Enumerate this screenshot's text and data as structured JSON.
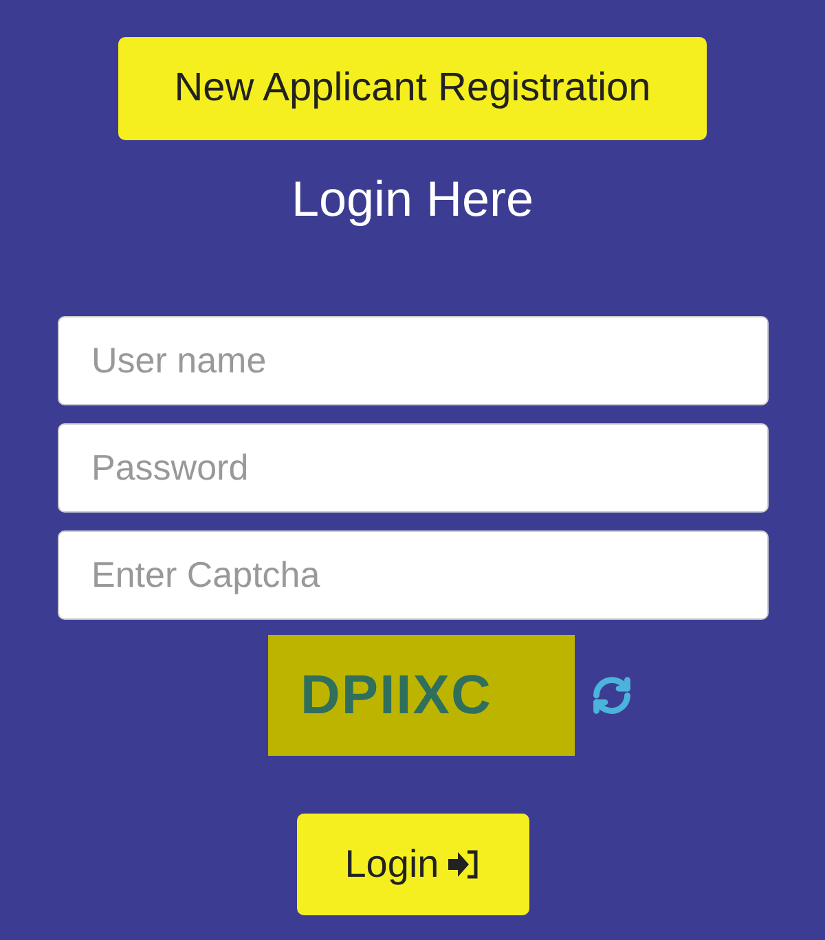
{
  "register_button": "New Applicant Registration",
  "title": "Login Here",
  "fields": [
    {
      "placeholder": "User name"
    },
    {
      "placeholder": "Password"
    },
    {
      "placeholder": "Enter Captcha"
    }
  ],
  "captcha": "DPIIXC",
  "login_button": "Login"
}
